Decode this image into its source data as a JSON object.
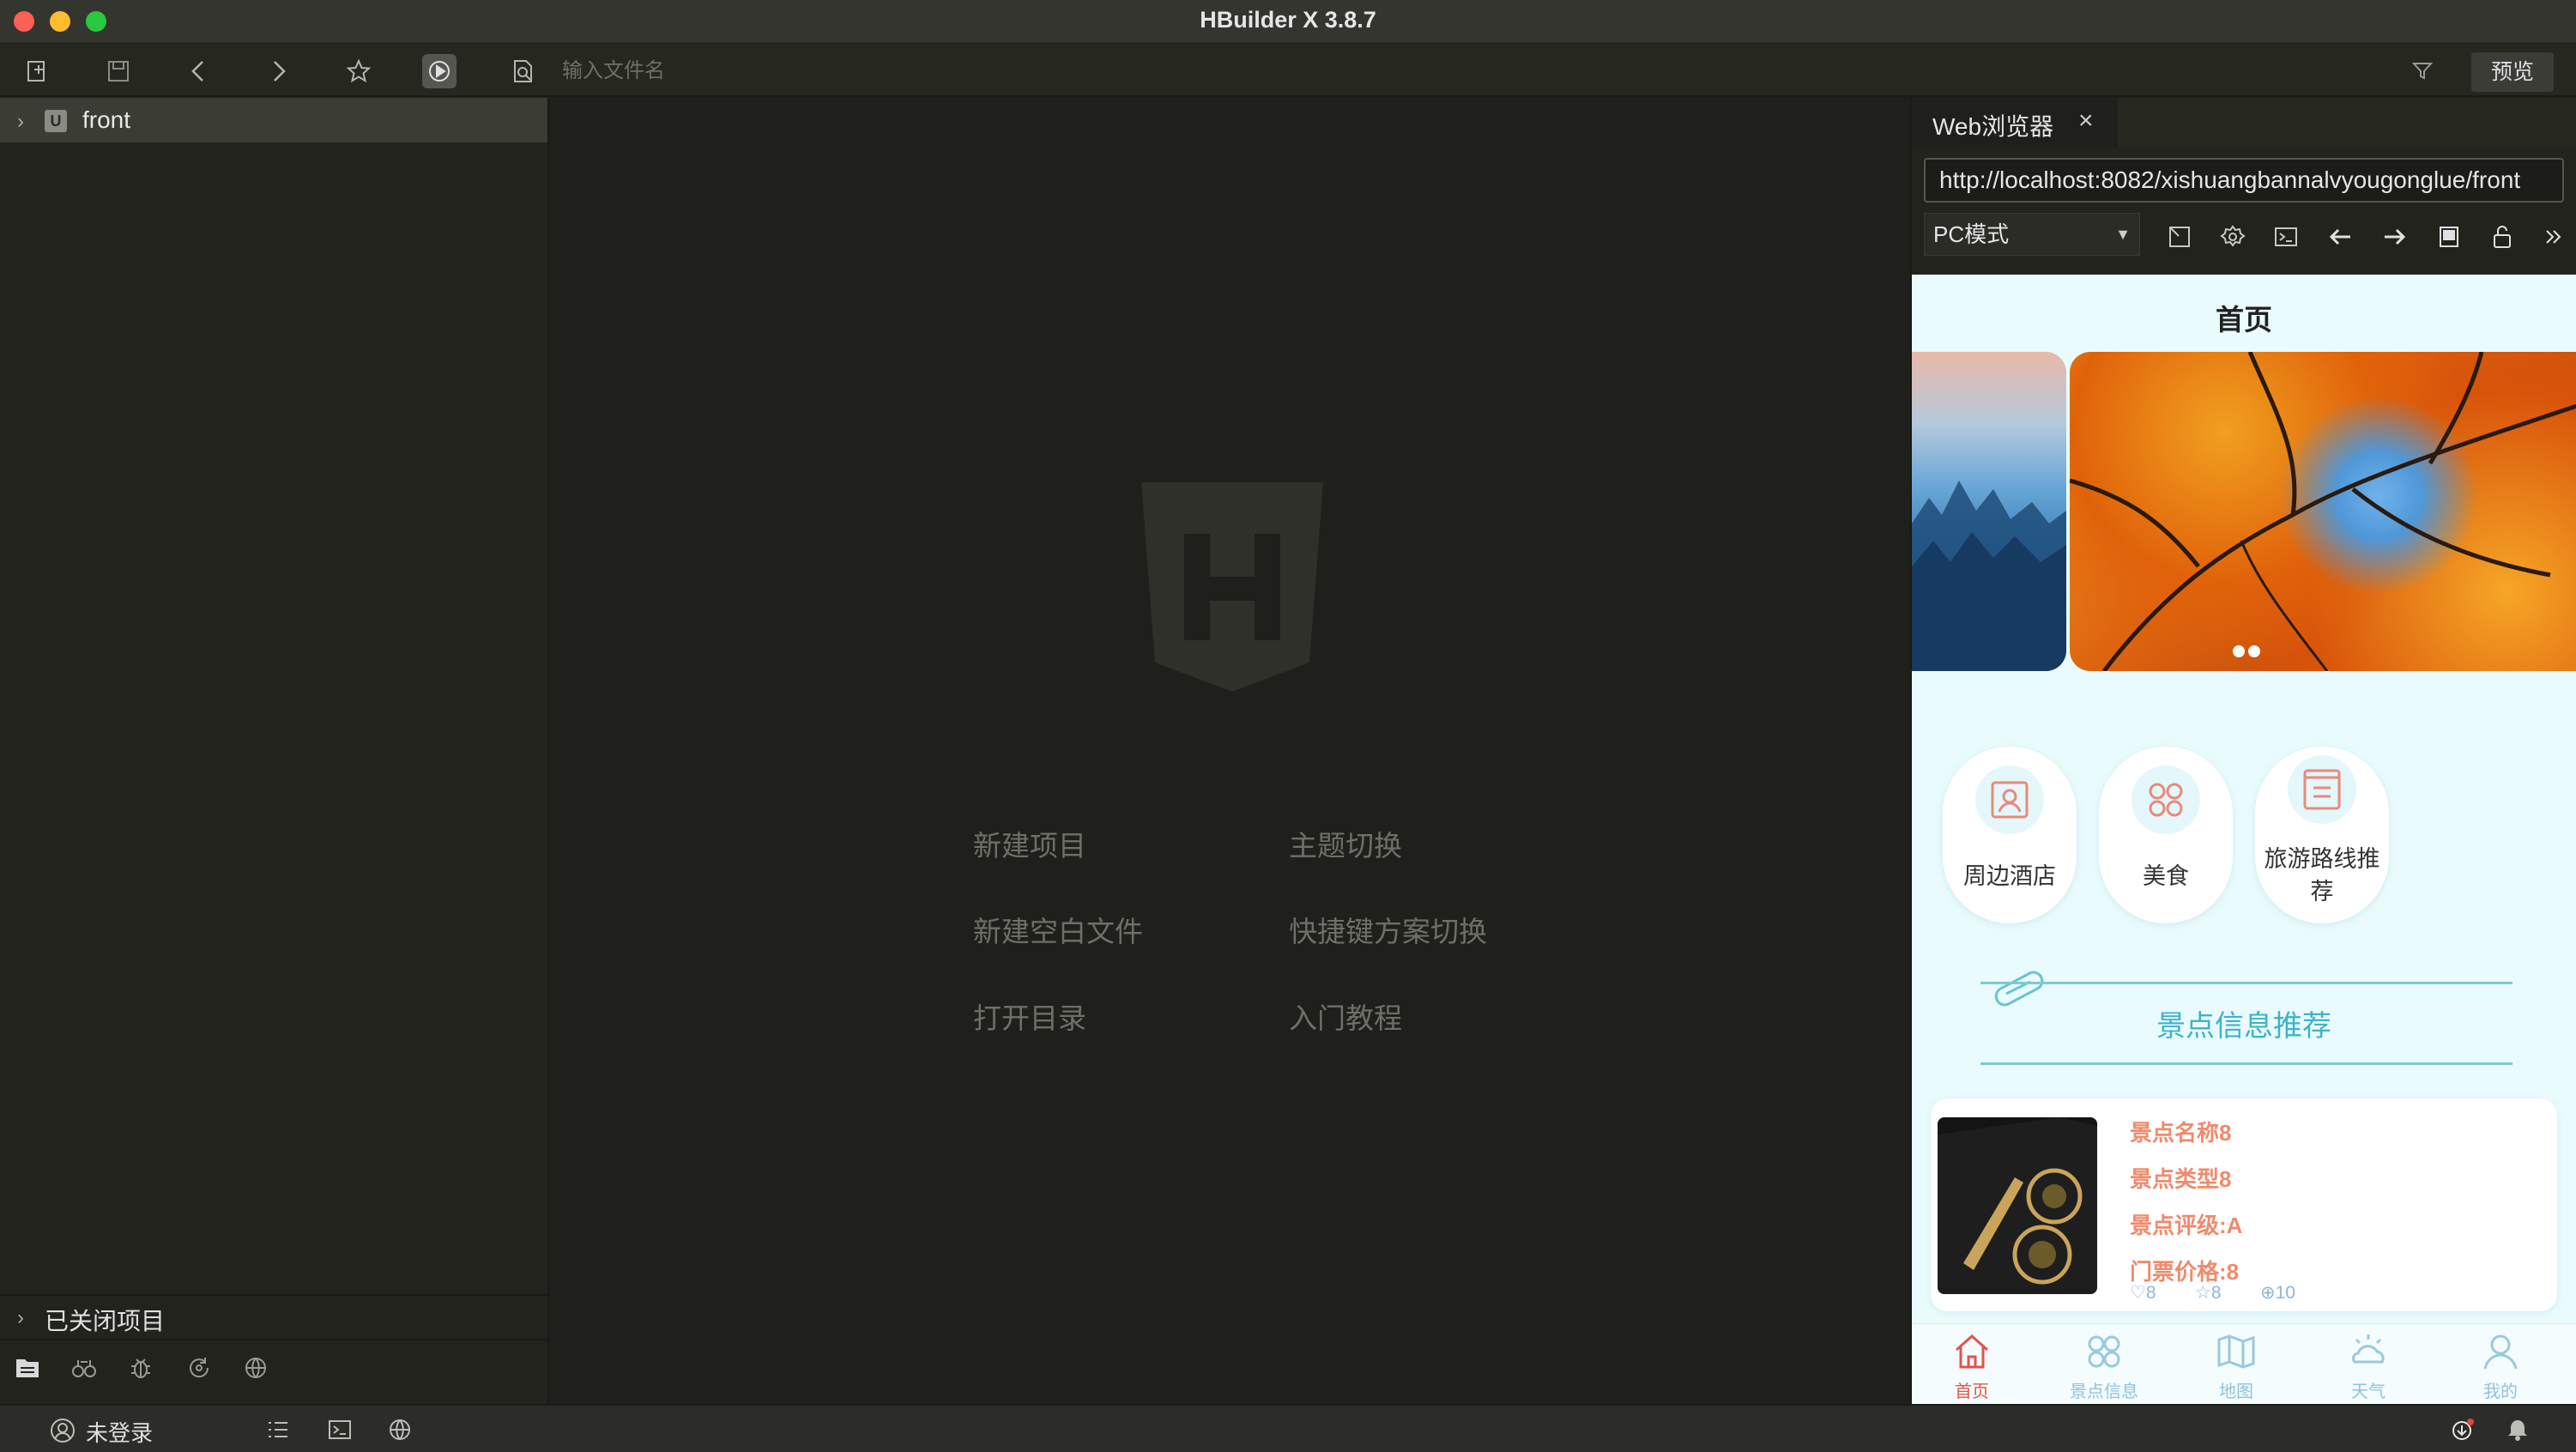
{
  "window": {
    "title": "HBuilder X 3.8.7"
  },
  "toolbar": {
    "file_search_placeholder": "输入文件名",
    "preview_label": "预览"
  },
  "sidebar": {
    "project_name": "front",
    "closed_projects_label": "已关闭项目"
  },
  "welcome": {
    "links": [
      "新建项目",
      "主题切换",
      "新建空白文件",
      "快捷键方案切换",
      "打开目录",
      "入门教程"
    ]
  },
  "browser": {
    "tab_label": "Web浏览器",
    "url": "http://localhost:8082/xishuangbannalvyougonglue/front",
    "mode": "PC模式"
  },
  "mobile": {
    "page_title": "首页",
    "categories": [
      "周边酒店",
      "美食",
      "旅游路线推荐"
    ],
    "section_title": "景点信息推荐",
    "card": {
      "name": "景点名称8",
      "type": "景点类型8",
      "rating": "景点评级:A",
      "price": "门票价格:8",
      "likes": "8",
      "favorites": "8",
      "views": "10"
    },
    "tabs": [
      "首页",
      "景点信息",
      "地图",
      "天气",
      "我的"
    ]
  },
  "statusbar": {
    "user": "未登录"
  },
  "colors": {
    "accent": "#3fb2c8",
    "active_tab": "#e0544a",
    "card_text": "#f08a6c"
  }
}
